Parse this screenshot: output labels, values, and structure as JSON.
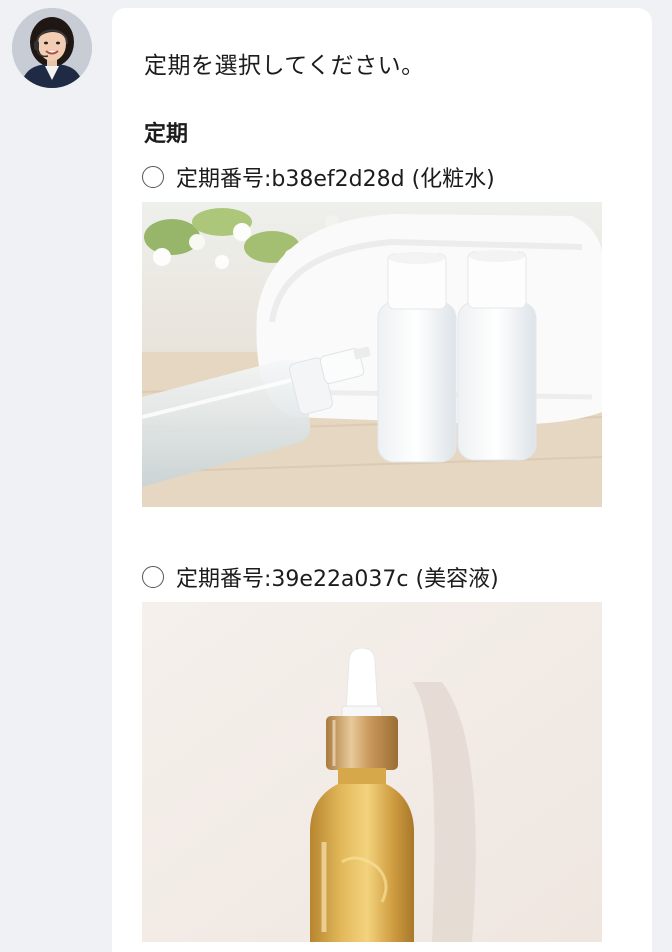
{
  "message": {
    "prompt": "定期を選択してください。",
    "section_title": "定期"
  },
  "options": [
    {
      "label": "定期番号:b38ef2d28d (化粧水)",
      "image": "toner-bottles-photo"
    },
    {
      "label": "定期番号:39e22a037c (美容液)",
      "image": "serum-dropper-bottle-photo"
    }
  ],
  "colors": {
    "page_background": "#f0f1f4",
    "bubble_background": "#ffffff",
    "text": "#1c1c1c"
  }
}
